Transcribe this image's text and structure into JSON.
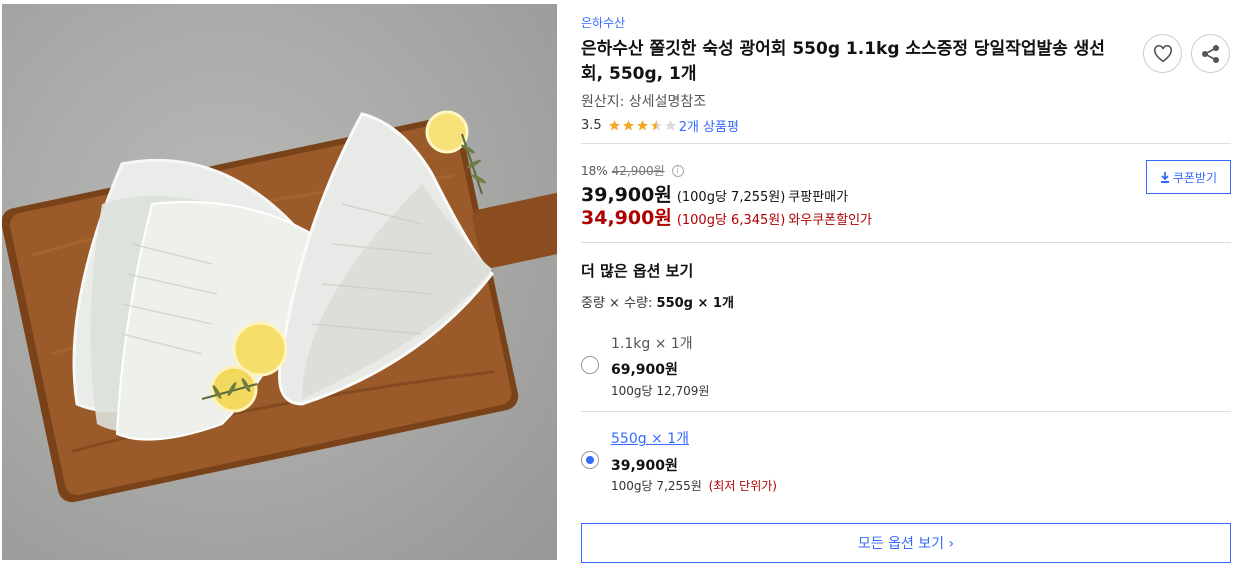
{
  "product": {
    "brand": "은하수산",
    "title": "은하수산 쫄깃한 숙성 광어회 550g 1.1kg 소스증정 당일작업발송 생선회, 550g, 1개",
    "origin": "원산지: 상세설명참조",
    "rating": {
      "score": "3.5",
      "stars": 3.5,
      "max_stars": 5,
      "review_text": "2개 상품평"
    },
    "image_alt": "광어회"
  },
  "actions": {
    "wishlist_icon": "heart-icon",
    "share_icon": "share-icon"
  },
  "pricing": {
    "discount_rate": "18%",
    "original_price": "42,900원",
    "sale_price": "39,900원",
    "sale_unit": "(100g당 7,255원)",
    "sale_label": "쿠팡판매가",
    "coupon_price": "34,900원",
    "coupon_unit": "(100g당 6,345원)",
    "coupon_label": "와우쿠폰할인가",
    "coupon_button": "쿠폰받기"
  },
  "options": {
    "title": "더 많은 옵션 보기",
    "summary_label": "중량 × 수량:",
    "summary_value": "550g × 1개",
    "items": [
      {
        "name": "1.1kg × 1개",
        "price": "69,900원",
        "unit": "100g당 12,709원",
        "note": "",
        "selected": false
      },
      {
        "name": "550g × 1개",
        "price": "39,900원",
        "unit": "100g당 7,255원",
        "note": "(최저 단위가)",
        "selected": true
      }
    ],
    "all_button": "모든 옵션 보기 ›"
  },
  "colors": {
    "accent": "#346aff",
    "price_red": "#ae0000",
    "star": "#f5a623",
    "board": "#8a4d22"
  }
}
